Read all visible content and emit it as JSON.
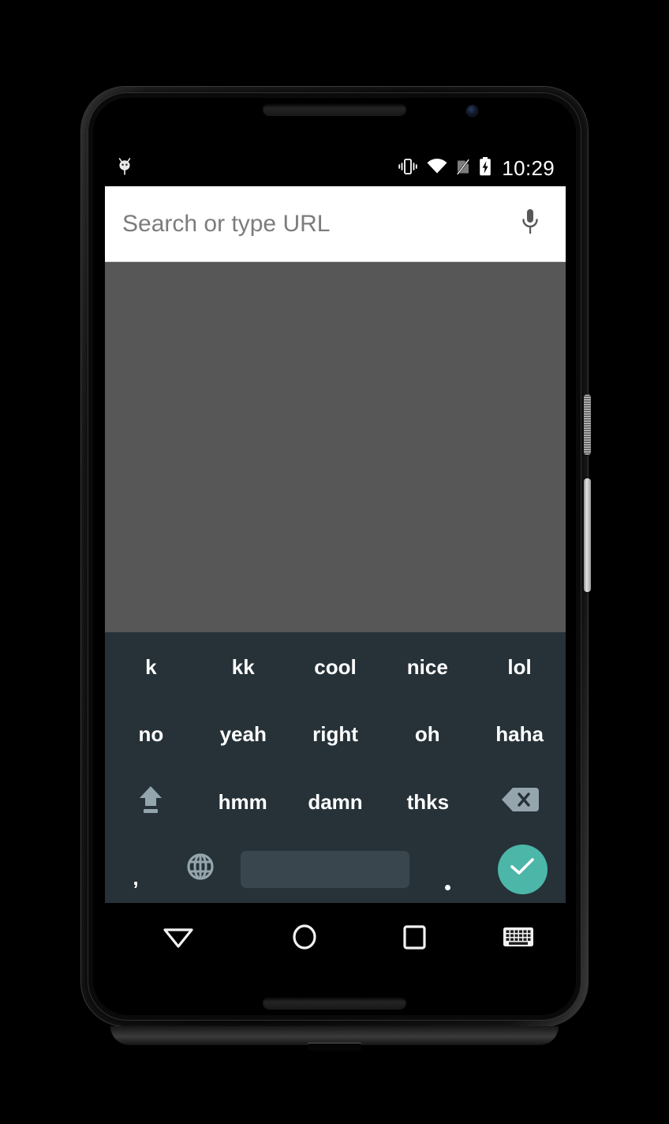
{
  "device": {
    "hardware": {
      "earpiece": "earpiece-speaker",
      "front_camera": "front-camera",
      "bottom_speaker": "bottom-speaker",
      "usb_port": "usb-port",
      "power_button": "power-button",
      "volume_button": "volume-rocker"
    }
  },
  "status_bar": {
    "notification_icon": "android-bugdroid-icon",
    "icons": [
      "vibrate-icon",
      "wifi-icon",
      "no-sim-icon",
      "battery-charging-icon"
    ],
    "time": "10:29"
  },
  "browser": {
    "omnibox": {
      "placeholder": "Search or type URL",
      "value": "",
      "voice_icon": "microphone-icon"
    },
    "page": {
      "background_color": "#575757",
      "content": ""
    }
  },
  "keyboard": {
    "background_color": "#263238",
    "key_text_color": "#ffffff",
    "accent_color": "#4CB6A9",
    "spacebar_color": "#3a464e",
    "rows": [
      {
        "id": "row-1",
        "keys": [
          {
            "label": "k",
            "name": "key-k"
          },
          {
            "label": "kk",
            "name": "key-kk"
          },
          {
            "label": "cool",
            "name": "key-cool"
          },
          {
            "label": "nice",
            "name": "key-nice"
          },
          {
            "label": "lol",
            "name": "key-lol"
          }
        ]
      },
      {
        "id": "row-2",
        "keys": [
          {
            "label": "no",
            "name": "key-no"
          },
          {
            "label": "yeah",
            "name": "key-yeah"
          },
          {
            "label": "right",
            "name": "key-right"
          },
          {
            "label": "oh",
            "name": "key-oh"
          },
          {
            "label": "haha",
            "name": "key-haha"
          }
        ]
      },
      {
        "id": "row-3",
        "keys": [
          {
            "label": "",
            "name": "shift-key",
            "icon": "shift-icon"
          },
          {
            "label": "hmm",
            "name": "key-hmm"
          },
          {
            "label": "damn",
            "name": "key-damn"
          },
          {
            "label": "thks",
            "name": "key-thks"
          },
          {
            "label": "",
            "name": "backspace-key",
            "icon": "backspace-icon"
          }
        ]
      },
      {
        "id": "row-4",
        "keys": [
          {
            "label": ",",
            "name": "key-comma"
          },
          {
            "label": "",
            "name": "language-switch-key",
            "icon": "globe-icon"
          },
          {
            "label": "",
            "name": "spacebar-key",
            "icon": "spacebar"
          },
          {
            "label": ".",
            "name": "key-period"
          },
          {
            "label": "",
            "name": "enter-key",
            "icon": "check-icon"
          }
        ]
      }
    ]
  },
  "nav_bar": {
    "buttons": [
      {
        "name": "back-button",
        "icon": "triangle-down-icon"
      },
      {
        "name": "home-button",
        "icon": "circle-icon"
      },
      {
        "name": "recents-button",
        "icon": "square-icon"
      },
      {
        "name": "ime-switcher-button",
        "icon": "keyboard-icon"
      }
    ]
  }
}
